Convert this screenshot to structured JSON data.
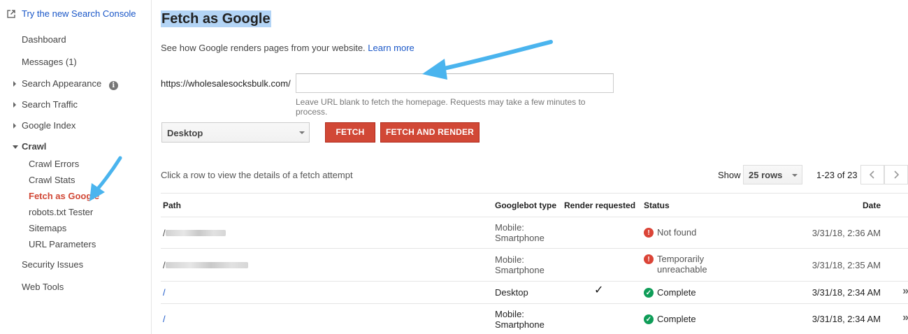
{
  "sidebar": {
    "try_new": "Try the new Search Console",
    "items": [
      {
        "label": "Dashboard"
      },
      {
        "label": "Messages (1)"
      },
      {
        "label": "Search Appearance"
      },
      {
        "label": "Search Traffic"
      },
      {
        "label": "Google Index"
      },
      {
        "label": "Crawl"
      },
      {
        "label": "Security Issues"
      },
      {
        "label": "Web Tools"
      }
    ],
    "crawl_sub": [
      {
        "label": "Crawl Errors"
      },
      {
        "label": "Crawl Stats"
      },
      {
        "label": "Fetch as Google"
      },
      {
        "label": "robots.txt Tester"
      },
      {
        "label": "Sitemaps"
      },
      {
        "label": "URL Parameters"
      }
    ],
    "info_glyph": "i"
  },
  "main": {
    "title": "Fetch as Google",
    "description": "See how Google renders pages from your website.",
    "learn_more": "Learn more",
    "url_prefix": "https://wholesalesocksbulk.com/",
    "url_value": "",
    "hint": "Leave URL blank to fetch the homepage. Requests may take a few minutes to process.",
    "device": "Desktop",
    "fetch_label": "FETCH",
    "fetch_render_label": "FETCH AND RENDER",
    "click_row_text": "Click a row to view the details of a fetch attempt",
    "show_label": "Show",
    "rows_selected": "25 rows",
    "range_text": "1-23 of 23"
  },
  "table": {
    "headers": {
      "path": "Path",
      "googlebot": "Googlebot type",
      "render": "Render requested",
      "status": "Status",
      "date": "Date"
    },
    "rows": [
      {
        "path": "/",
        "bot_line1": "Mobile:",
        "bot_line2": "Smartphone",
        "render": "",
        "status_line1": "Not found",
        "status_line2": "",
        "date": "3/31/18, 2:36 AM"
      },
      {
        "path": "/",
        "bot_line1": "Mobile:",
        "bot_line2": "Smartphone",
        "render": "",
        "status_line1": "Temporarily",
        "status_line2": "unreachable",
        "date": "3/31/18, 2:35 AM"
      },
      {
        "path": "/",
        "bot_line1": "Desktop",
        "bot_line2": "",
        "render": "✓",
        "status_line1": "Complete",
        "status_line2": "",
        "date": "3/31/18, 2:34 AM"
      },
      {
        "path": "/",
        "bot_line1": "Mobile:",
        "bot_line2": "Smartphone",
        "render": "",
        "status_line1": "Complete",
        "status_line2": "",
        "date": "3/31/18, 2:34 AM"
      }
    ],
    "status_icons": {
      "error": "!",
      "ok": "✓"
    },
    "chevron": "»"
  },
  "colors": {
    "link": "#1a57c8",
    "active_nav": "#d14836",
    "button_red": "#d14836",
    "title_highlight": "#b3d4f5",
    "annotation_arrow": "#4ab4ee",
    "error_icon": "#db4437",
    "ok_icon": "#0f9d58"
  }
}
